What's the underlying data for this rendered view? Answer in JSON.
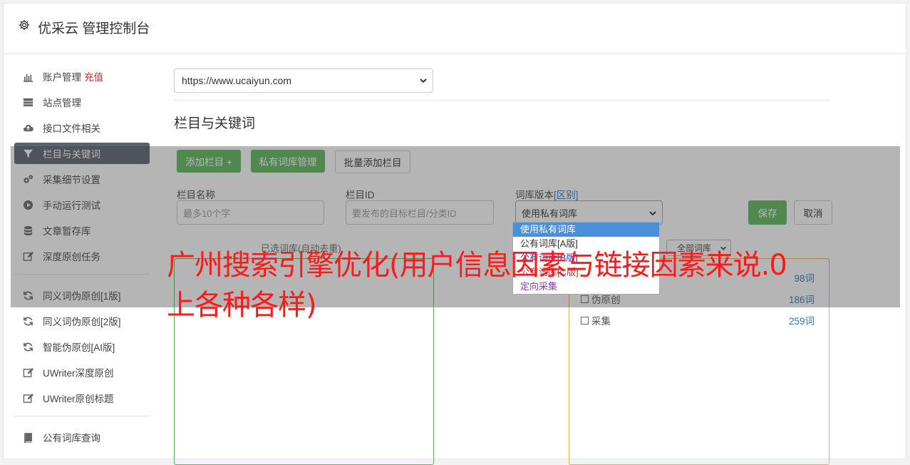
{
  "header": {
    "title": "优采云 管理控制台",
    "icon": "gear-icon"
  },
  "sidebar": {
    "items": [
      {
        "label": "账户管理",
        "extra": "充值",
        "icon": "bar-chart-icon"
      },
      {
        "label": "站点管理",
        "icon": "server-icon"
      },
      {
        "label": "接口文件相关",
        "icon": "cloud-upload-icon"
      },
      {
        "label": "栏目与关键词",
        "icon": "filter-icon",
        "active": true
      },
      {
        "label": "采集细节设置",
        "icon": "cogs-icon"
      },
      {
        "label": "手动运行测试",
        "icon": "play-circle-icon"
      },
      {
        "label": "文章暂存库",
        "icon": "database-icon"
      },
      {
        "label": "深度原创任务",
        "icon": "edit-icon"
      }
    ],
    "items2": [
      {
        "label": "同义词伪原创[1版]",
        "icon": "refresh-icon"
      },
      {
        "label": "同义词伪原创[2版]",
        "icon": "refresh-icon"
      },
      {
        "label": "智能伪原创[AI版]",
        "icon": "refresh-icon"
      },
      {
        "label": "UWriter深度原创",
        "icon": "edit-icon"
      },
      {
        "label": "UWriter原创标题",
        "icon": "edit-icon"
      }
    ],
    "items3": [
      {
        "label": "公有词库查询",
        "icon": "book-icon"
      }
    ]
  },
  "main": {
    "site_select": "https://www.ucaiyun.com",
    "section_title": "栏目与关键词",
    "buttons": {
      "add_column": "添加栏目 +",
      "private_lib": "私有词库管理",
      "batch_add": "批量添加栏目",
      "save": "保存",
      "cancel": "取消"
    },
    "form": {
      "name_label": "栏目名称",
      "name_placeholder": "最多10个字",
      "id_label": "栏目ID",
      "id_placeholder": "要发布的目标栏目/分类ID",
      "version_label": "词库版本",
      "version_link": "[区别]",
      "version_value": "使用私有词库"
    },
    "version_options": [
      {
        "label": "使用私有词库",
        "color": "#ffffff",
        "selected": true
      },
      {
        "label": "公有词库[A版]",
        "color": "#333333"
      },
      {
        "label": "公有词库[B版]",
        "color": "#3333cc"
      },
      {
        "label": "公有词库[C版]",
        "color": "#cc3333"
      },
      {
        "label": "定向采集",
        "color": "#9933cc"
      }
    ],
    "left_caption": "已选词库(自动去重)",
    "filter_select": "全部词库",
    "lib_rows": [
      {
        "label": "",
        "count": "98词"
      },
      {
        "label": "伪原创",
        "count": "186词"
      },
      {
        "label": "采集",
        "count": "259词"
      }
    ]
  },
  "headline": "广州搜索引擎优化(用户信息因素与链接因素来说.0上各种各样)"
}
